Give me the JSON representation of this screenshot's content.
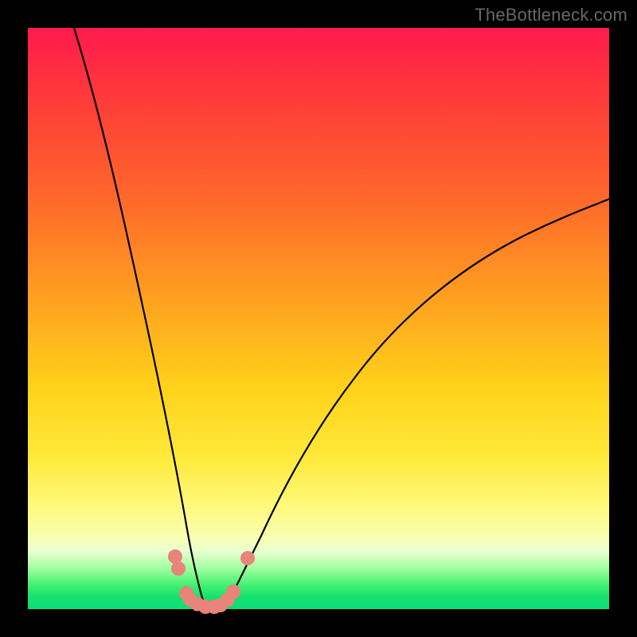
{
  "watermark": "TheBottleneck.com",
  "chart_data": {
    "type": "line",
    "title": "",
    "xlabel": "",
    "ylabel": "",
    "xlim": [
      0,
      100
    ],
    "ylim": [
      0,
      100
    ],
    "grid": false,
    "legend": false,
    "background_gradient": [
      "#ff1a4d",
      "#ffa51f",
      "#ffe93a",
      "#0adf7a"
    ],
    "series": [
      {
        "name": "left-curve",
        "color": "#000000",
        "x": [
          8,
          10,
          12,
          14,
          16,
          18,
          20,
          22,
          24,
          25.5,
          27,
          28.5,
          29.5
        ],
        "y": [
          100,
          90,
          78,
          66,
          55,
          44,
          33,
          23,
          14,
          8,
          4,
          1.5,
          0.5
        ]
      },
      {
        "name": "right-curve",
        "color": "#000000",
        "x": [
          34,
          36,
          39,
          43,
          48,
          54,
          61,
          69,
          78,
          88,
          100
        ],
        "y": [
          0.5,
          2,
          6,
          12,
          20,
          29,
          38,
          47,
          55,
          62,
          68
        ]
      },
      {
        "name": "valley-floor",
        "color": "#000000",
        "x": [
          29.5,
          31,
          32.5,
          34
        ],
        "y": [
          0.5,
          0,
          0,
          0.5
        ]
      }
    ],
    "markers": [
      {
        "name": "salmon-dots",
        "color": "#e8847a",
        "radius_px": 9,
        "points": [
          {
            "x": 25.4,
            "y": 9
          },
          {
            "x": 25.9,
            "y": 7
          },
          {
            "x": 27.2,
            "y": 2.8
          },
          {
            "x": 28.0,
            "y": 1.7
          },
          {
            "x": 29.2,
            "y": 0.9
          },
          {
            "x": 30.5,
            "y": 0.4
          },
          {
            "x": 32.0,
            "y": 0.4
          },
          {
            "x": 33.2,
            "y": 0.7
          },
          {
            "x": 34.4,
            "y": 1.6
          },
          {
            "x": 35.3,
            "y": 3.0
          },
          {
            "x": 37.8,
            "y": 8.8
          }
        ]
      }
    ]
  }
}
